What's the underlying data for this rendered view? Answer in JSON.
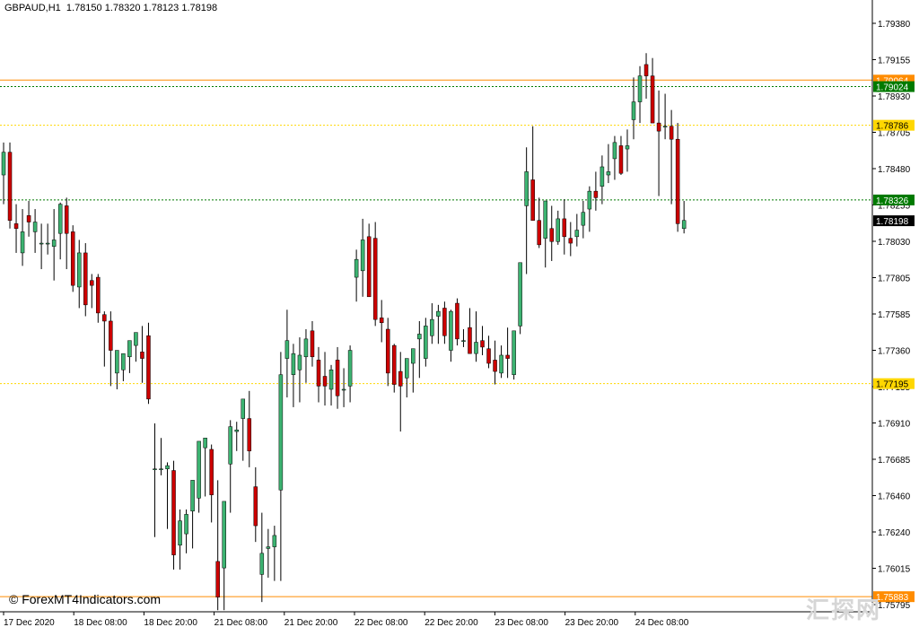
{
  "chart_data": {
    "type": "candlestick",
    "symbol": "GBPAUD,H1",
    "ohlc_header": "1.78150 1.78320 1.78123 1.78198",
    "price_ticks": [
      "1.79380",
      "1.79155",
      "1.78930",
      "1.78705",
      "1.78480",
      "1.78255",
      "1.78030",
      "1.77805",
      "1.77585",
      "1.77360",
      "1.77135",
      "1.76910",
      "1.76685",
      "1.76460",
      "1.76240",
      "1.76015",
      "1.75795"
    ],
    "time_labels": [
      "17 Dec 2020",
      "18 Dec 08:00",
      "18 Dec 20:00",
      "21 Dec 08:00",
      "21 Dec 20:00",
      "22 Dec 08:00",
      "22 Dec 20:00",
      "23 Dec 08:00",
      "23 Dec 20:00",
      "24 Dec 08:00"
    ],
    "ylim": [
      1.7579,
      1.7948
    ],
    "horizontal_levels": [
      {
        "price": 1.79064,
        "label": "1.79064",
        "color": "#ff8c00",
        "style": "solid"
      },
      {
        "price": 1.79024,
        "label": "1.79024",
        "color": "#007a00",
        "style": "dotted"
      },
      {
        "price": 1.78786,
        "label": "1.78786",
        "color": "#ffd700",
        "style": "dotted"
      },
      {
        "price": 1.78326,
        "label": "1.78326",
        "color": "#007a00",
        "style": "dotted"
      },
      {
        "price": 1.77195,
        "label": "1.77195",
        "color": "#ffd700",
        "style": "dotted"
      },
      {
        "price": 1.75883,
        "label": "1.75883",
        "color": "#ff8c00",
        "style": "solid"
      }
    ],
    "current_price": {
      "price": 1.78198,
      "label": "1.78198",
      "color": "#000000"
    },
    "bull_color": "#3cb371",
    "bear_color": "#cc0000",
    "candles": [
      [
        1.7848,
        1.7868,
        1.783,
        1.7862
      ],
      [
        1.7862,
        1.7868,
        1.7815,
        1.782
      ],
      [
        1.7818,
        1.783,
        1.78,
        1.7815
      ],
      [
        1.78,
        1.7827,
        1.7792,
        1.7813
      ],
      [
        1.7823,
        1.7832,
        1.781,
        1.7819
      ],
      [
        1.7813,
        1.7827,
        1.78,
        1.7819
      ],
      [
        1.7806,
        1.7818,
        1.779,
        1.7806
      ],
      [
        1.7806,
        1.7818,
        1.7799,
        1.7806
      ],
      [
        1.7804,
        1.7827,
        1.7783,
        1.7808
      ],
      [
        1.7812,
        1.7831,
        1.7796,
        1.783
      ],
      [
        1.7829,
        1.7834,
        1.779,
        1.7812
      ],
      [
        1.7813,
        1.7817,
        1.7776,
        1.778
      ],
      [
        1.7779,
        1.7808,
        1.7766,
        1.78
      ],
      [
        1.78,
        1.7806,
        1.7761,
        1.7768
      ],
      [
        1.7783,
        1.7787,
        1.7766,
        1.778
      ],
      [
        1.7785,
        1.7787,
        1.7757,
        1.7763
      ],
      [
        1.7762,
        1.7764,
        1.773,
        1.7758
      ],
      [
        1.7758,
        1.7764,
        1.7718,
        1.774
      ],
      [
        1.7726,
        1.7736,
        1.7716,
        1.774
      ],
      [
        1.7728,
        1.7738,
        1.7721,
        1.7738
      ],
      [
        1.7736,
        1.7742,
        1.7726,
        1.7746
      ],
      [
        1.7743,
        1.775,
        1.7733,
        1.7751
      ],
      [
        1.7739,
        1.7755,
        1.772,
        1.7735
      ],
      [
        1.7749,
        1.7757,
        1.7707,
        1.771
      ],
      [
        1.7667,
        1.7695,
        1.7625,
        1.7667
      ],
      [
        1.7667,
        1.7686,
        1.7663,
        1.7667
      ],
      [
        1.7667,
        1.7671,
        1.763,
        1.7669
      ],
      [
        1.7666,
        1.7672,
        1.7605,
        1.7614
      ],
      [
        1.762,
        1.7642,
        1.7605,
        1.7635
      ],
      [
        1.7627,
        1.7642,
        1.7615,
        1.7639
      ],
      [
        1.7641,
        1.7652,
        1.7618,
        1.766
      ],
      [
        1.7649,
        1.768,
        1.764,
        1.7684
      ],
      [
        1.768,
        1.7684,
        1.765,
        1.7686
      ],
      [
        1.7679,
        1.7682,
        1.7634,
        1.7651
      ],
      [
        1.761,
        1.766,
        1.758,
        1.7588
      ],
      [
        1.7606,
        1.7638,
        1.758,
        1.7647
      ],
      [
        1.767,
        1.7697,
        1.764,
        1.7693
      ],
      [
        1.769,
        1.7696,
        1.7678,
        1.7691
      ],
      [
        1.7698,
        1.7706,
        1.7672,
        1.771
      ],
      [
        1.7698,
        1.7715,
        1.7668,
        1.7678
      ],
      [
        1.7656,
        1.7668,
        1.7622,
        1.7632
      ],
      [
        1.7602,
        1.764,
        1.7585,
        1.7615
      ],
      [
        1.7618,
        1.763,
        1.76,
        1.7619
      ],
      [
        1.7619,
        1.7632,
        1.7598,
        1.7626
      ],
      [
        1.7654,
        1.7739,
        1.7598,
        1.7725
      ],
      [
        1.7735,
        1.7765,
        1.7711,
        1.7746
      ],
      [
        1.7725,
        1.7744,
        1.7705,
        1.7738
      ],
      [
        1.7728,
        1.7748,
        1.7708,
        1.7737
      ],
      [
        1.7736,
        1.7753,
        1.772,
        1.7747
      ],
      [
        1.7752,
        1.7758,
        1.773,
        1.7736
      ],
      [
        1.7734,
        1.7742,
        1.7708,
        1.7718
      ],
      [
        1.7724,
        1.7739,
        1.7706,
        1.7718
      ],
      [
        1.7716,
        1.7731,
        1.7706,
        1.7728
      ],
      [
        1.7734,
        1.7742,
        1.7704,
        1.7712
      ],
      [
        1.7716,
        1.7729,
        1.7705,
        1.7716
      ],
      [
        1.7718,
        1.7743,
        1.7708,
        1.774
      ],
      [
        1.7785,
        1.7802,
        1.777,
        1.7796
      ],
      [
        1.7789,
        1.7821,
        1.7773,
        1.7808
      ],
      [
        1.781,
        1.7818,
        1.7776,
        1.7773
      ],
      [
        1.7809,
        1.7819,
        1.7755,
        1.7759
      ],
      [
        1.776,
        1.7771,
        1.7745,
        1.7757
      ],
      [
        1.7753,
        1.776,
        1.7718,
        1.7726
      ],
      [
        1.7743,
        1.7744,
        1.7714,
        1.7719
      ],
      [
        1.7727,
        1.7739,
        1.769,
        1.7718
      ],
      [
        1.7723,
        1.7735,
        1.7711,
        1.7735
      ],
      [
        1.7732,
        1.774,
        1.7714,
        1.7741
      ],
      [
        1.7747,
        1.7758,
        1.7723,
        1.775
      ],
      [
        1.7735,
        1.776,
        1.773,
        1.7755
      ],
      [
        1.7749,
        1.7769,
        1.7744,
        1.7759
      ],
      [
        1.7761,
        1.7768,
        1.7744,
        1.7764
      ],
      [
        1.7766,
        1.777,
        1.7744,
        1.7749
      ],
      [
        1.774,
        1.7765,
        1.7733,
        1.7764
      ],
      [
        1.7769,
        1.7772,
        1.7743,
        1.7747
      ],
      [
        1.7746,
        1.7753,
        1.7742,
        1.7746
      ],
      [
        1.7754,
        1.7766,
        1.7742,
        1.7738
      ],
      [
        1.7738,
        1.7764,
        1.7733,
        1.7745
      ],
      [
        1.7746,
        1.7755,
        1.7737,
        1.7742
      ],
      [
        1.7741,
        1.7749,
        1.7729,
        1.7732
      ],
      [
        1.7734,
        1.7746,
        1.7719,
        1.7727
      ],
      [
        1.7726,
        1.7743,
        1.7723,
        1.7737
      ],
      [
        1.7737,
        1.7754,
        1.7723,
        1.7735
      ],
      [
        1.7725,
        1.7752,
        1.7722,
        1.7752
      ],
      [
        1.7755,
        1.7791,
        1.775,
        1.7794
      ],
      [
        1.7829,
        1.7865,
        1.7787,
        1.785
      ],
      [
        1.7845,
        1.7878,
        1.7822,
        1.782
      ],
      [
        1.782,
        1.7834,
        1.7803,
        1.7805
      ],
      [
        1.7809,
        1.7825,
        1.7791,
        1.7832
      ],
      [
        1.7815,
        1.7829,
        1.7795,
        1.7807
      ],
      [
        1.7807,
        1.7826,
        1.7805,
        1.7821
      ],
      [
        1.7821,
        1.7833,
        1.7799,
        1.781
      ],
      [
        1.7809,
        1.7819,
        1.7798,
        1.7806
      ],
      [
        1.781,
        1.7824,
        1.7804,
        1.7814
      ],
      [
        1.7817,
        1.7832,
        1.7809,
        1.7825
      ],
      [
        1.7827,
        1.7841,
        1.7813,
        1.7838
      ],
      [
        1.7838,
        1.785,
        1.7826,
        1.7834
      ],
      [
        1.7841,
        1.786,
        1.783,
        1.7853
      ],
      [
        1.7848,
        1.7867,
        1.7843,
        1.785
      ],
      [
        1.7858,
        1.7872,
        1.7845,
        1.7868
      ],
      [
        1.7866,
        1.7872,
        1.7848,
        1.7849
      ],
      [
        1.7864,
        1.7876,
        1.785,
        1.7866
      ],
      [
        1.7882,
        1.7908,
        1.787,
        1.7893
      ],
      [
        1.7893,
        1.7915,
        1.788,
        1.7909
      ],
      [
        1.7916,
        1.7923,
        1.7895,
        1.7909
      ],
      [
        1.7909,
        1.792,
        1.7881,
        1.788
      ],
      [
        1.788,
        1.79,
        1.7835,
        1.7875
      ],
      [
        1.7878,
        1.7898,
        1.787,
        1.7878
      ],
      [
        1.7878,
        1.7888,
        1.783,
        1.787
      ],
      [
        1.787,
        1.788,
        1.7813,
        1.7818
      ],
      [
        1.7815,
        1.7832,
        1.7812,
        1.782
      ]
    ]
  }
}
